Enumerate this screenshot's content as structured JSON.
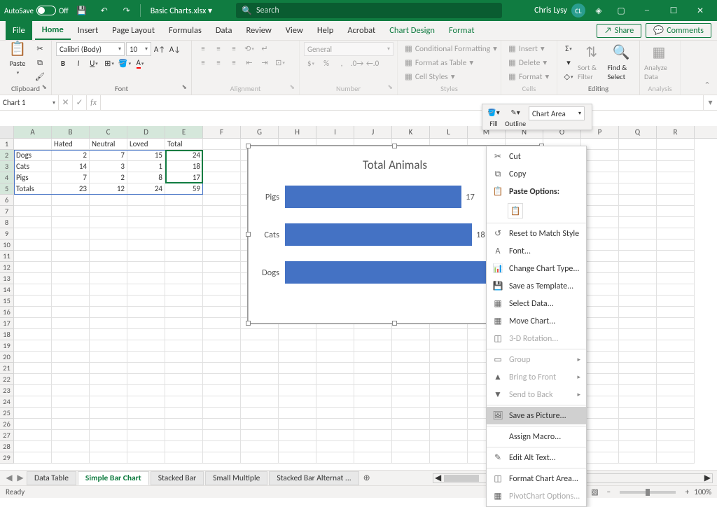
{
  "titlebar": {
    "autosave_label": "AutoSave",
    "autosave_state": "Off",
    "filename": "Basic Charts.xlsx ▾",
    "search_placeholder": "Search",
    "user_name": "Chris Lysy",
    "user_initials": "CL"
  },
  "tabs": {
    "file": "File",
    "home": "Home",
    "insert": "Insert",
    "page_layout": "Page Layout",
    "formulas": "Formulas",
    "data": "Data",
    "review": "Review",
    "view": "View",
    "help": "Help",
    "acrobat": "Acrobat",
    "chart_design": "Chart Design",
    "format": "Format",
    "share": "Share",
    "comments": "Comments"
  },
  "ribbon": {
    "clipboard": {
      "paste": "Paste",
      "label": "Clipboard"
    },
    "font": {
      "name": "Calibri (Body)",
      "size": "10",
      "label": "Font"
    },
    "alignment": {
      "label": "Alignment"
    },
    "number": {
      "format": "General",
      "label": "Number"
    },
    "styles": {
      "cond_fmt": "Conditional Formatting",
      "fmt_table": "Format as Table",
      "cell_styles": "Cell Styles",
      "label": "Styles"
    },
    "cells": {
      "insert": "Insert",
      "delete": "Delete",
      "format": "Format",
      "label": "Cells"
    },
    "editing": {
      "sort": "Sort & Filter",
      "find": "Find & Select",
      "label": "Editing"
    },
    "analysis": {
      "analyze": "Analyze Data",
      "label": "Analysis"
    }
  },
  "fill_outline": {
    "fill": "Fill",
    "outline": "Outline",
    "selector": "Chart Area"
  },
  "namebox": "Chart 1",
  "columns": [
    "A",
    "B",
    "C",
    "D",
    "E",
    "F",
    "G",
    "H",
    "I",
    "J",
    "K",
    "L",
    "M",
    "N",
    "O",
    "P",
    "Q",
    "R"
  ],
  "rows": [
    1,
    2,
    3,
    4,
    5,
    6,
    7,
    8,
    9,
    10,
    11,
    12,
    13,
    14,
    15,
    16,
    17,
    18,
    19,
    20,
    21,
    22,
    23,
    24,
    25,
    26,
    27,
    28,
    29
  ],
  "table": {
    "headers": [
      "",
      "Hated",
      "Neutral",
      "Loved",
      "Total"
    ],
    "rows": [
      {
        "label": "Dogs",
        "vals": [
          2,
          7,
          15,
          24
        ]
      },
      {
        "label": "Cats",
        "vals": [
          14,
          3,
          1,
          18
        ]
      },
      {
        "label": "Pigs",
        "vals": [
          7,
          2,
          8,
          17
        ]
      },
      {
        "label": "Totals",
        "vals": [
          23,
          12,
          24,
          59
        ]
      }
    ]
  },
  "chart_data": {
    "type": "bar",
    "title": "Total Animals",
    "categories": [
      "Pigs",
      "Cats",
      "Dogs"
    ],
    "values": [
      17,
      18,
      24
    ],
    "max": 24,
    "color": "#4472c4"
  },
  "context_menu": [
    {
      "icon": "✂",
      "label": "Cut",
      "u": "t"
    },
    {
      "icon": "⧉",
      "label": "Copy",
      "u": "C"
    },
    {
      "header": "Paste Options:"
    },
    {
      "paste": true
    },
    {
      "sep": true
    },
    {
      "icon": "↺",
      "label": "Reset to Match Style"
    },
    {
      "icon": "A",
      "label": "Font..."
    },
    {
      "icon": "📊",
      "label": "Change Chart Type..."
    },
    {
      "icon": "💾",
      "label": "Save as Template..."
    },
    {
      "icon": "▦",
      "label": "Select Data..."
    },
    {
      "icon": "▦",
      "label": "Move Chart..."
    },
    {
      "icon": "◫",
      "label": "3-D Rotation...",
      "dim": true
    },
    {
      "sep": true
    },
    {
      "icon": "▭",
      "label": "Group",
      "sub": true,
      "dim": true
    },
    {
      "icon": "▲",
      "label": "Bring to Front",
      "sub": true,
      "dim": true
    },
    {
      "icon": "▼",
      "label": "Send to Back",
      "sub": true,
      "dim": true
    },
    {
      "sep": true
    },
    {
      "icon": "🖼",
      "label": "Save as Picture...",
      "hl": true
    },
    {
      "sep": true
    },
    {
      "icon": "",
      "label": "Assign Macro..."
    },
    {
      "sep": true
    },
    {
      "icon": "✎",
      "label": "Edit Alt Text..."
    },
    {
      "sep": true
    },
    {
      "icon": "◫",
      "label": "Format Chart Area..."
    },
    {
      "icon": "▦",
      "label": "PivotChart Options...",
      "dim": true
    }
  ],
  "sheet_tabs": [
    "Data Table",
    "Simple Bar Chart",
    "Stacked Bar",
    "Small Multiple",
    "Stacked Bar Alternat ..."
  ],
  "active_sheet": 1,
  "status": {
    "ready": "Ready",
    "zoom": "100%"
  }
}
